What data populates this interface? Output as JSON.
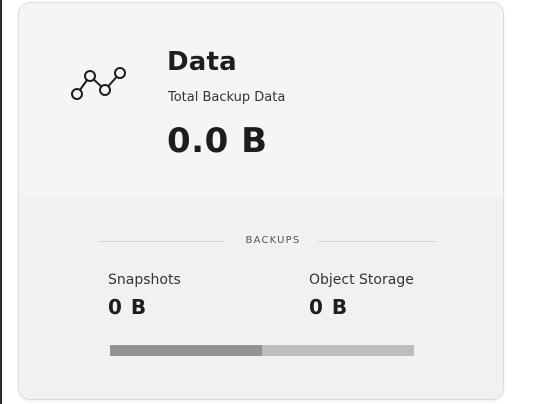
{
  "card": {
    "icon": "line-chart-icon",
    "title": "Data",
    "subtitle": "Total Backup Data",
    "total_value": "0.0 B"
  },
  "backups": {
    "section_label": "BACKUPS",
    "snapshots": {
      "label": "Snapshots",
      "value": "0 B"
    },
    "object_storage": {
      "label": "Object Storage",
      "value": "0 B"
    },
    "split_bar": {
      "snapshots_fraction": 0.5
    }
  },
  "colors": {
    "text_primary": "#1d1d1f",
    "bar_snapshots": "#939393",
    "bar_object_storage": "#bdbdbd"
  }
}
